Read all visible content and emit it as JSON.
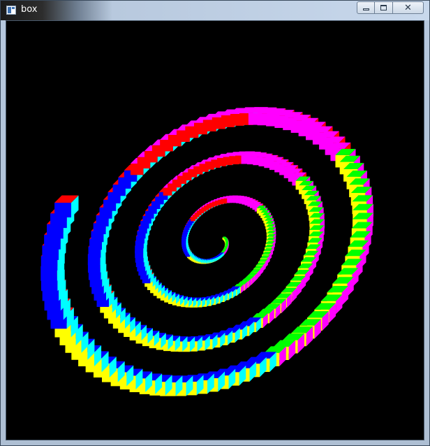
{
  "window": {
    "title": "box",
    "icon": "app-window-icon",
    "controls": {
      "minimize_icon": "minimize-icon",
      "maximize_icon": "maximize-icon",
      "close_icon": "close-icon"
    }
  },
  "scene": {
    "background": "#000000",
    "palette": {
      "magenta": "#ff00ff",
      "yellow": "#ffff00",
      "green": "#00ff00",
      "red": "#ff0000",
      "blue": "#0000ff",
      "cyan": "#00ffff"
    }
  }
}
